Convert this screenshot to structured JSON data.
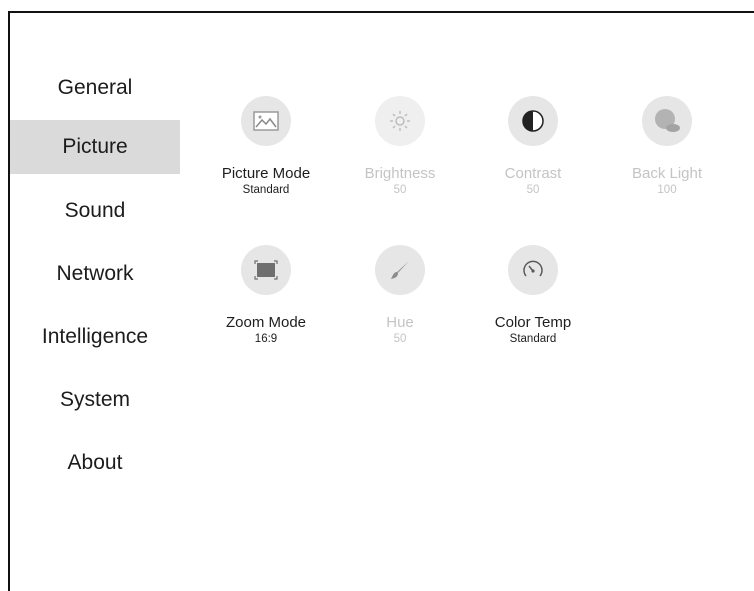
{
  "sidebar": {
    "items": [
      {
        "label": "General"
      },
      {
        "label": "Picture",
        "active": true
      },
      {
        "label": "Sound"
      },
      {
        "label": "Network"
      },
      {
        "label": "Intelligence"
      },
      {
        "label": "System"
      },
      {
        "label": "About"
      }
    ]
  },
  "settings": {
    "tiles": [
      {
        "label": "Picture Mode",
        "value": "Standard",
        "icon": "image-icon",
        "enabled": true
      },
      {
        "label": "Brightness",
        "value": "50",
        "icon": "sun-icon",
        "enabled": false
      },
      {
        "label": "Contrast",
        "value": "50",
        "icon": "contrast-icon",
        "enabled": false
      },
      {
        "label": "Back Light",
        "value": "100",
        "icon": "backlight-icon",
        "enabled": false
      },
      {
        "label": "Zoom Mode",
        "value": "16:9",
        "icon": "zoom-frame-icon",
        "enabled": true
      },
      {
        "label": "Hue",
        "value": "50",
        "icon": "brush-icon",
        "enabled": false
      },
      {
        "label": "Color Temp",
        "value": "Standard",
        "icon": "gauge-icon",
        "enabled": true
      }
    ]
  },
  "colors": {
    "active_nav_bg": "#dadada",
    "icon_circle_bg": "#e6e6e6",
    "disabled_text": "#c4c4c4"
  }
}
